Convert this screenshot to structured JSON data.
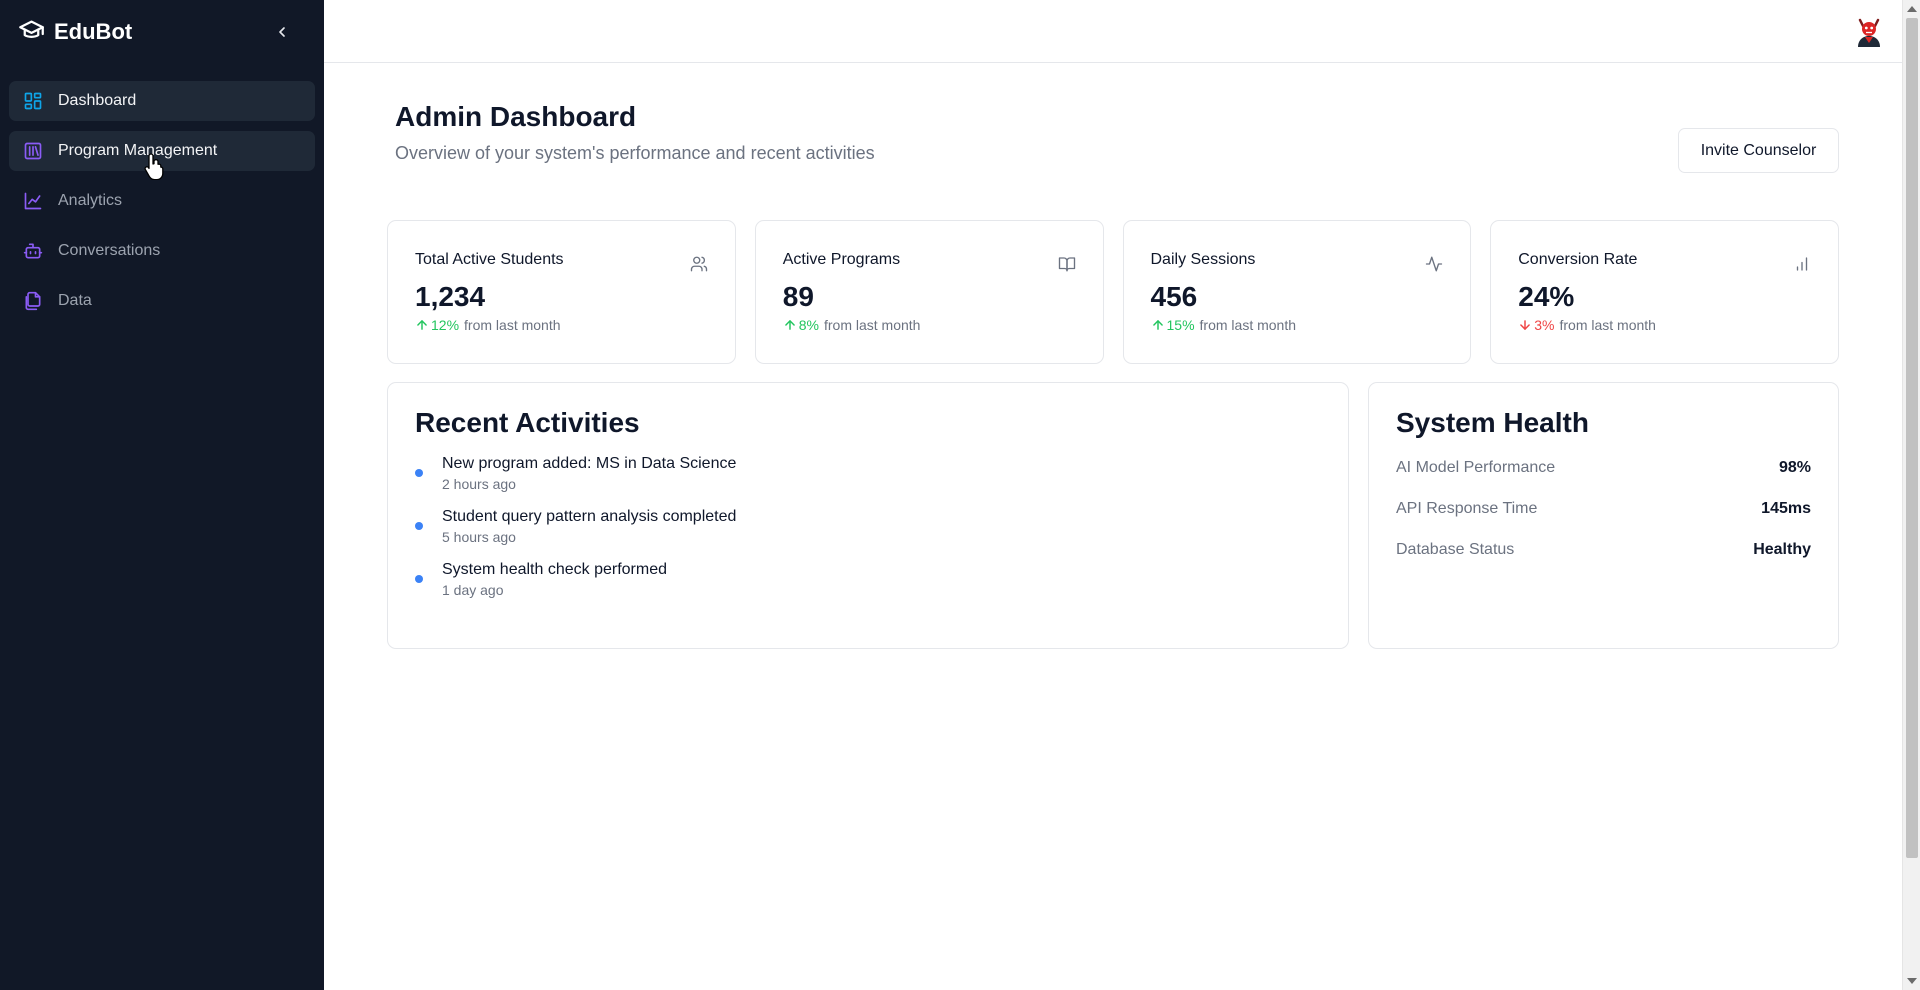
{
  "app": {
    "name": "EduBot",
    "logo_icon": "graduation-cap-icon",
    "collapse_icon": "chevron-left-icon"
  },
  "sidebar": {
    "items": [
      {
        "label": "Dashboard",
        "icon": "layout-grid-icon",
        "state": "active"
      },
      {
        "label": "Program Management",
        "icon": "library-icon",
        "state": "hover"
      },
      {
        "label": "Analytics",
        "icon": "line-chart-icon",
        "state": "default"
      },
      {
        "label": "Conversations",
        "icon": "bot-icon",
        "state": "default"
      },
      {
        "label": "Data",
        "icon": "files-icon",
        "state": "default"
      }
    ]
  },
  "header": {
    "title": "Admin Dashboard",
    "subtitle": "Overview of your system's performance and recent activities",
    "invite_label": "Invite Counselor"
  },
  "stats": [
    {
      "title": "Total Active Students",
      "value": "1,234",
      "delta": "12%",
      "direction": "up",
      "suffix": "from last month",
      "icon": "users-icon"
    },
    {
      "title": "Active Programs",
      "value": "89",
      "delta": "8%",
      "direction": "up",
      "suffix": "from last month",
      "icon": "book-open-icon"
    },
    {
      "title": "Daily Sessions",
      "value": "456",
      "delta": "15%",
      "direction": "up",
      "suffix": "from last month",
      "icon": "activity-icon"
    },
    {
      "title": "Conversion Rate",
      "value": "24%",
      "delta": "3%",
      "direction": "down",
      "suffix": "from last month",
      "icon": "bar-chart-icon"
    }
  ],
  "activities": {
    "title": "Recent Activities",
    "items": [
      {
        "title": "New program added: MS in Data Science",
        "time": "2 hours ago"
      },
      {
        "title": "Student query pattern analysis completed",
        "time": "5 hours ago"
      },
      {
        "title": "System health check performed",
        "time": "1 day ago"
      }
    ]
  },
  "health": {
    "title": "System Health",
    "rows": [
      {
        "label": "AI Model Performance",
        "value": "98%"
      },
      {
        "label": "API Response Time",
        "value": "145ms"
      },
      {
        "label": "Database Status",
        "value": "Healthy"
      }
    ]
  },
  "colors": {
    "sidebar_bg": "#111827",
    "accent_blue": "#0ea5e9",
    "accent_purple": "#8b5cf6",
    "positive": "#22c55e",
    "negative": "#ef4444",
    "activity_dot": "#3b82f6"
  }
}
